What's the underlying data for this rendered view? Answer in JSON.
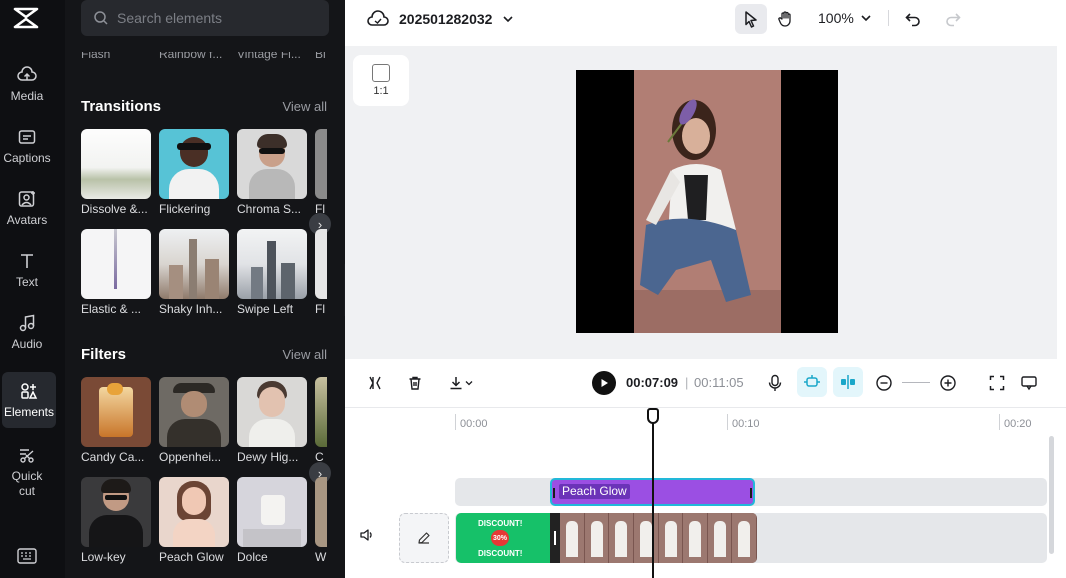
{
  "rail": {
    "items": [
      {
        "label": "Media",
        "icon": "cloud-upload-icon"
      },
      {
        "label": "Captions",
        "icon": "captions-icon"
      },
      {
        "label": "Avatars",
        "icon": "avatar-icon"
      },
      {
        "label": "Text",
        "icon": "text-icon"
      },
      {
        "label": "Audio",
        "icon": "music-note-icon"
      },
      {
        "label": "Elements",
        "icon": "elements-icon",
        "active": true
      },
      {
        "label": "Quick cut",
        "icon": "quick-cut-icon"
      }
    ]
  },
  "panel": {
    "search_placeholder": "Search elements",
    "cut_labels": [
      "Flash",
      "Rainbow f...",
      "Vintage Fi...",
      "Bl"
    ],
    "transitions": {
      "title": "Transitions",
      "view_all": "View all",
      "row1": [
        "Dissolve &...",
        "Flickering",
        "Chroma S...",
        "Fl"
      ],
      "row2": [
        "Elastic & ...",
        "Shaky Inh...",
        "Swipe Left",
        "Fl"
      ]
    },
    "filters": {
      "title": "Filters",
      "view_all": "View all",
      "row1": [
        "Candy Ca...",
        "Oppenhei...",
        "Dewy Hig...",
        "C"
      ],
      "row2": [
        "Low-key",
        "Peach Glow",
        "Dolce",
        "W"
      ]
    }
  },
  "topbar": {
    "project_name": "202501282032",
    "zoom": "100%"
  },
  "canvas": {
    "ratio": "1:1"
  },
  "timeline": {
    "current_time": "00:07:09",
    "separator": "|",
    "total_time": "00:11:05",
    "ruler": [
      "00:00",
      "00:10",
      "00:20"
    ],
    "effect_clip_label": "Peach Glow",
    "green_clip_top": "DISCOUNT!",
    "green_clip_badge": "30%",
    "green_clip_bottom": "DISCOUNT!"
  },
  "colors": {
    "rail_bg": "#0e0f12",
    "panel_bg": "#141518",
    "effect_clip": "#9b4fe3",
    "clip_selection": "#22b8d9",
    "green_clip": "#16c169",
    "highlight_button": "#e3f6fb"
  }
}
